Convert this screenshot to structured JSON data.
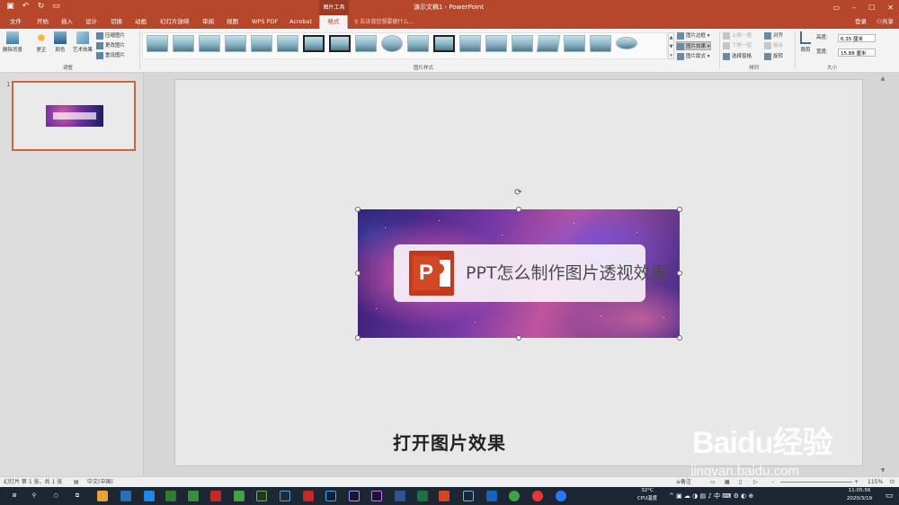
{
  "window": {
    "title": "演示文稿1 - PowerPoint",
    "context_group": "图片工具",
    "controls": [
      "–",
      "☐",
      "✕"
    ]
  },
  "quick_access": [
    "save",
    "undo",
    "redo",
    "present"
  ],
  "tabs": [
    {
      "label": "文件"
    },
    {
      "label": "开始"
    },
    {
      "label": "插入"
    },
    {
      "label": "设计"
    },
    {
      "label": "切换"
    },
    {
      "label": "动画"
    },
    {
      "label": "幻灯片放映"
    },
    {
      "label": "审阅"
    },
    {
      "label": "视图"
    },
    {
      "label": "WPS PDF"
    },
    {
      "label": "Acrobat"
    },
    {
      "label": "格式"
    }
  ],
  "tell_me": "告诉我您想要做什么...",
  "account": {
    "login": "登录",
    "share": "共享"
  },
  "ribbon": {
    "adjust": {
      "remove_bg": "删除背景",
      "correct": "更正",
      "color": "颜色",
      "artistic": "艺术效果",
      "compress": "压缩图片",
      "change": "更改图片",
      "reset": "重设图片",
      "group_label": "调整"
    },
    "styles": {
      "group_label": "图片样式"
    },
    "style_cmds": {
      "border": "图片边框",
      "effects": "图片效果",
      "layout": "图片版式"
    },
    "arrange": {
      "bring_forward": "上移一层",
      "send_backward": "下移一层",
      "selection_pane": "选择窗格",
      "align": "对齐",
      "group": "组合",
      "rotate": "旋转",
      "group_label": "排列"
    },
    "size": {
      "crop": "裁剪",
      "height_label": "高度:",
      "height_value": "6.35 厘米",
      "width_label": "宽度:",
      "width_value": "15.88 厘米",
      "group_label": "大小"
    }
  },
  "thumbnail": {
    "number": "1",
    "mini_text": "PPT怎么制作图片透视效果"
  },
  "slide": {
    "banner_title": "PPT怎么制作图片透视效果",
    "logo_letter": "P",
    "caption": "打开图片效果"
  },
  "status": {
    "slide_info": "幻灯片 第 1 张，共 1 张",
    "language": "中文(中国)",
    "notes": "备注",
    "zoom": "115%"
  },
  "watermark": {
    "logo": "Baidu经验",
    "url": "jingyan.baidu.com"
  },
  "taskbar": {
    "weather_temp": "32°C",
    "weather_label": "CPU温度",
    "time": "11:05:56",
    "date": "2020/3/19"
  }
}
